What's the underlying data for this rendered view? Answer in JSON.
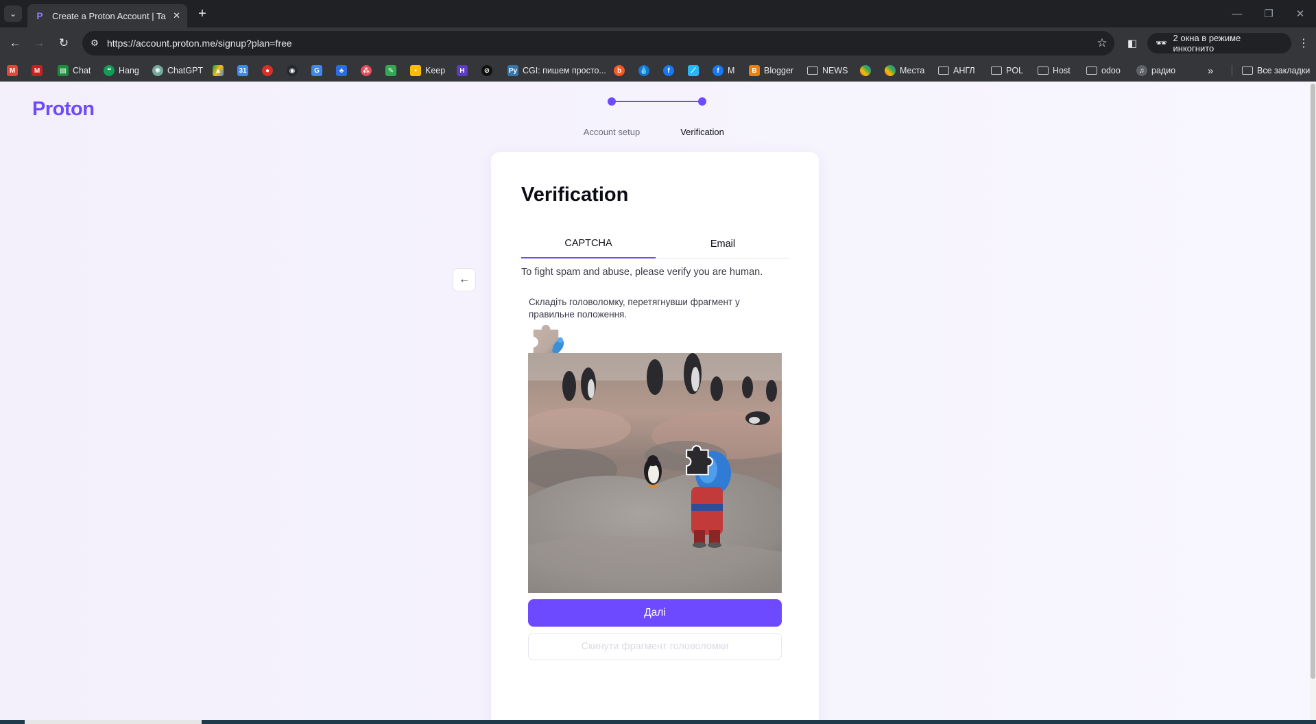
{
  "browser": {
    "tab_title": "Create a Proton Account | Take",
    "tab_favicon": "proton-p-icon",
    "url": "https://account.proton.me/signup?plan=free",
    "incognito_label": "2 окна в режиме инкогнито",
    "all_bookmarks": "Все закладки",
    "bookmarks": [
      {
        "label": "",
        "icon": "gmail-icon"
      },
      {
        "label": "",
        "icon": "gmail-icon"
      },
      {
        "label": "Chat",
        "icon": "google-chat-icon"
      },
      {
        "label": "Hang",
        "icon": "hangouts-icon"
      },
      {
        "label": "ChatGPT",
        "icon": "chatgpt-icon"
      },
      {
        "label": "",
        "icon": "google-drive-icon"
      },
      {
        "label": "",
        "icon": "calendar-icon"
      },
      {
        "label": "",
        "icon": "app-icon"
      },
      {
        "label": "",
        "icon": "github-icon"
      },
      {
        "label": "",
        "icon": "translate-icon"
      },
      {
        "label": "",
        "icon": "app-icon"
      },
      {
        "label": "",
        "icon": "app-icon"
      },
      {
        "label": "",
        "icon": "app-icon"
      },
      {
        "label": "Keep",
        "icon": "keep-icon"
      },
      {
        "label": "",
        "icon": "app-icon"
      },
      {
        "label": "",
        "icon": "app-icon"
      },
      {
        "label": "CGI: пишем просто...",
        "icon": "python-icon"
      },
      {
        "label": "",
        "icon": "app-icon"
      },
      {
        "label": "",
        "icon": "app-icon"
      },
      {
        "label": "",
        "icon": "facebook-icon"
      },
      {
        "label": "",
        "icon": "app-icon"
      },
      {
        "label": "M",
        "icon": "facebook-icon"
      },
      {
        "label": "Blogger",
        "icon": "blogger-icon"
      },
      {
        "label": "NEWS",
        "icon": "folder-icon"
      },
      {
        "label": "",
        "icon": "pinwheel-icon"
      },
      {
        "label": "Места",
        "icon": "pinwheel-icon"
      },
      {
        "label": "АНГЛ",
        "icon": "folder-icon"
      },
      {
        "label": "POL",
        "icon": "folder-icon"
      },
      {
        "label": "Host",
        "icon": "folder-icon"
      },
      {
        "label": "odoo",
        "icon": "folder-icon"
      },
      {
        "label": "радио",
        "icon": "headphones-icon"
      }
    ]
  },
  "page": {
    "logo": "Proton",
    "steps": [
      {
        "label": "Account setup",
        "state": "done"
      },
      {
        "label": "Verification",
        "state": "current"
      }
    ],
    "title": "Verification",
    "tabs": [
      {
        "label": "CAPTCHA",
        "active": true
      },
      {
        "label": "Email",
        "active": false
      }
    ],
    "intro": "To fight spam and abuse, please verify you are human.",
    "puzzle_hint": "Складіть головоломку, перетягнувши фрагмент у правильне положення.",
    "next_button": "Далі",
    "reset_button": "Скинути фрагмент головоломки"
  },
  "colors": {
    "accent": "#6d4aff",
    "page_bg": "#f5f2fd"
  }
}
